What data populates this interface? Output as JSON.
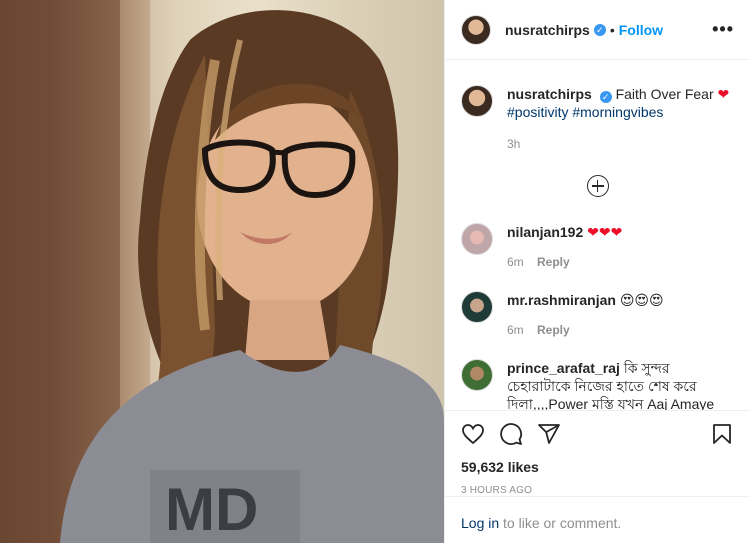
{
  "post": {
    "username": "nusratchirps",
    "follow_label": "Follow",
    "more_label": "•••",
    "caption_text": "Faith Over Fear",
    "caption_emoji": "❤",
    "hashtags": "#positivity #morningvibes",
    "caption_time": "3h",
    "likes": "59,632 likes",
    "timestamp": "3 HOURS AGO"
  },
  "comments": [
    {
      "username": "nilanjan192",
      "text": "❤❤❤",
      "time": "6m",
      "reply_label": "Reply"
    },
    {
      "username": "mr.rashmiranjan",
      "text": "😍😍😍",
      "time": "6m",
      "reply_label": "Reply"
    },
    {
      "username": "prince_arafat_raj",
      "text": "কি সুন্দর চেহারাটাকে নিজের হাতে শেষ করে দিলা,,,,Power মস্তি যখন Aaj Amaye গান আসলো ,ছোট ছিলাম তখন ,,এইগানটা",
      "time": "",
      "reply_label": ""
    }
  ],
  "footer": {
    "login_label": "Log in",
    "login_suffix": " to like or comment."
  },
  "icons": {
    "like": "heart-icon",
    "comment": "comment-icon",
    "share": "share-icon",
    "save": "bookmark-icon",
    "load_more": "plus-circle-icon"
  },
  "colors": {
    "link": "#0095f6",
    "hashtag": "#00376b",
    "heart": "#ed0f2a",
    "muted": "#8e8e8e"
  }
}
